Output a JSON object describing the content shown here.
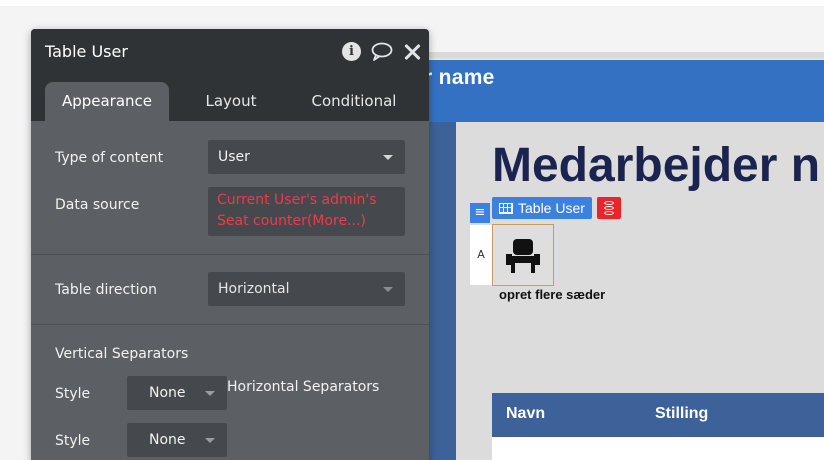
{
  "canvas": {
    "header_name": "r name",
    "page_heading": "Medarbejder n",
    "table_tag_label": "Table User",
    "row_label": "A",
    "seat_caption": "opret flere sæder",
    "list_columns": [
      "Navn",
      "Stilling"
    ],
    "colors": {
      "header_blue": "#3471c3",
      "list_header": "#3d6199",
      "tag_blue": "#3b82e0",
      "tag_red": "#e8252a"
    }
  },
  "panel": {
    "title": "Table User",
    "icons": [
      "info-icon",
      "comment-icon",
      "close-icon"
    ],
    "tabs": [
      {
        "label": "Appearance",
        "active": true
      },
      {
        "label": "Layout",
        "active": false
      },
      {
        "label": "Conditional",
        "active": false
      }
    ],
    "type_of_content": {
      "label": "Type of content",
      "value": "User"
    },
    "data_source": {
      "label": "Data source",
      "value": "Current User's admin's Seat counter(More...)"
    },
    "table_direction": {
      "label": "Table direction",
      "value": "Horizontal"
    },
    "vertical_separators": {
      "label": "Vertical Separators",
      "style_label": "Style",
      "style_value": "None"
    },
    "horizontal_separators": {
      "label": "Horizontal Separators",
      "style_label": "Style",
      "style_value": "None"
    }
  }
}
